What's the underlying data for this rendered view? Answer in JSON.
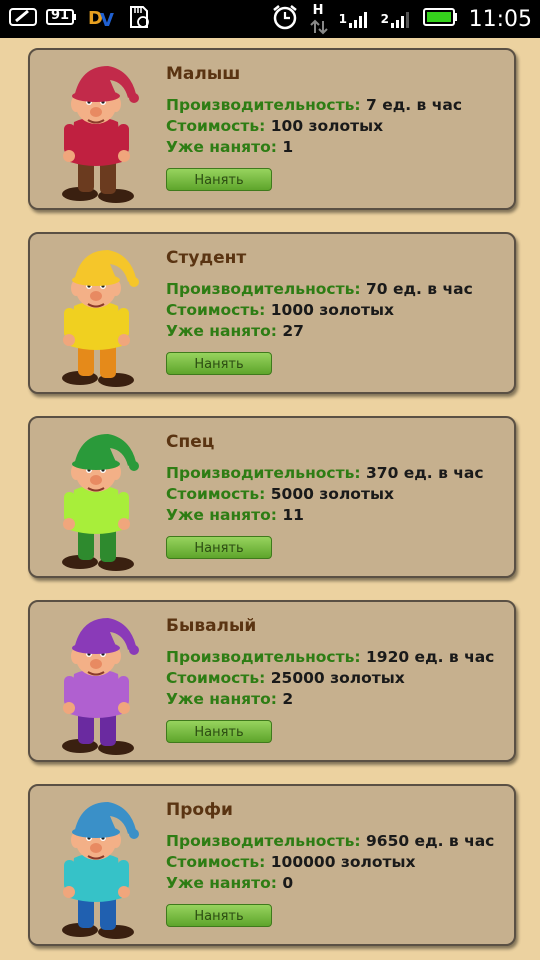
{
  "theme": {
    "background": "#ecd2a0",
    "card": "#c6b08e",
    "accent_green": "#2e7d14",
    "title_brown": "#5a3412"
  },
  "status_bar": {
    "battery_left": "91",
    "signal_1_label": "1",
    "signal_2_label": "2",
    "network_type": "H",
    "time": "11:05",
    "icons": [
      "message-icon",
      "battery-icon",
      "dv-logo-icon",
      "sd-sync-icon",
      "alarm-icon",
      "network-h-icon",
      "signal-icon",
      "signal-icon",
      "battery-full-icon"
    ]
  },
  "labels": {
    "productivity": "Производительность:",
    "cost": "Стоимость:",
    "hired": "Уже нанято:"
  },
  "workers": [
    {
      "name": "Малыш",
      "productivity": "7 ед. в час",
      "cost": "100 золотых",
      "hired": "1",
      "button": "Нанять",
      "hat_color": "#c22a4a",
      "shirt_color": "#c02040",
      "pants_color": "#6b3b1f"
    },
    {
      "name": "Студент",
      "productivity": "70 ед. в час",
      "cost": "1000 золотых",
      "hired": "27",
      "button": "Нанять",
      "hat_color": "#f5c62a",
      "shirt_color": "#f0d020",
      "pants_color": "#e58a1a"
    },
    {
      "name": "Спец",
      "productivity": "370 ед. в час",
      "cost": "5000 золотых",
      "hired": "11",
      "button": "Нанять",
      "hat_color": "#2a9a3a",
      "shirt_color": "#a8ee3a",
      "pants_color": "#2e8a2e"
    },
    {
      "name": "Бывалый",
      "productivity": "1920 ед. в час",
      "cost": "25000 золотых",
      "hired": "2",
      "button": "Нанять",
      "hat_color": "#8a3ab8",
      "shirt_color": "#b060d0",
      "pants_color": "#6a2aa0"
    },
    {
      "name": "Профи",
      "productivity": "9650 ед. в час",
      "cost": "100000 золотых",
      "hired": "0",
      "button": "Нанять",
      "hat_color": "#3a90c8",
      "shirt_color": "#36c2c8",
      "pants_color": "#2060b0"
    }
  ]
}
